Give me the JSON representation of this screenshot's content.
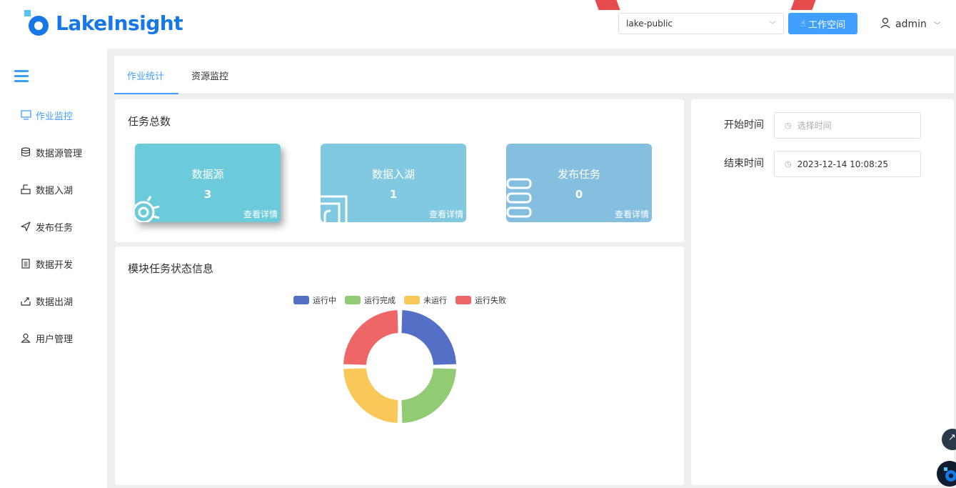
{
  "header": {
    "brand": "LakeInsight",
    "workspace_select": "lake-public",
    "workspace_button": "工作空间",
    "user": "admin"
  },
  "sidebar": {
    "items": [
      {
        "label": "作业监控",
        "icon": "monitor-icon"
      },
      {
        "label": "数据源管理",
        "icon": "database-icon"
      },
      {
        "label": "数据入湖",
        "icon": "import-icon"
      },
      {
        "label": "发布任务",
        "icon": "send-icon"
      },
      {
        "label": "数据开发",
        "icon": "document-icon"
      },
      {
        "label": "数据出湖",
        "icon": "export-icon"
      },
      {
        "label": "用户管理",
        "icon": "user-icon"
      }
    ]
  },
  "tabs": [
    {
      "label": "作业统计"
    },
    {
      "label": "资源监控"
    }
  ],
  "task_total": {
    "title": "任务总数",
    "cards": [
      {
        "title": "数据源",
        "value": "3",
        "link": "查看详情",
        "color": "#6ccbdb"
      },
      {
        "title": "数据入湖",
        "value": "1",
        "link": "查看详情",
        "color": "#80c9e0"
      },
      {
        "title": "发布任务",
        "value": "0",
        "link": "查看详情",
        "color": "#85bfe0"
      }
    ]
  },
  "status_panel": {
    "title": "模块任务状态信息",
    "legend": [
      {
        "label": "运行中",
        "color": "#5470c6"
      },
      {
        "label": "运行完成",
        "color": "#91cc75"
      },
      {
        "label": "未运行",
        "color": "#fac858"
      },
      {
        "label": "运行失败",
        "color": "#ee6666"
      }
    ]
  },
  "filters": {
    "start_label": "开始时间",
    "start_placeholder": "选择时间",
    "end_label": "结束时间",
    "end_value": "2023-12-14 10:08:25"
  },
  "colors": {
    "accent": "#409eff",
    "brand": "#1677e6"
  }
}
